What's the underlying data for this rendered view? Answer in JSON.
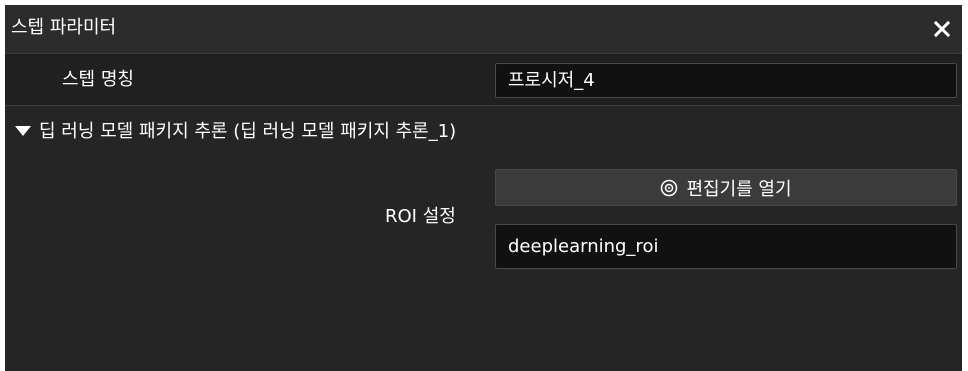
{
  "window": {
    "title": "스텝 파라미터",
    "close_icon": "close-icon"
  },
  "step_name": {
    "label": "스텝 명칭",
    "value": "프로시저_4"
  },
  "section": {
    "expanded_icon": "caret-down-icon",
    "title": "딥 러닝 모델 패키지 추론 (딥 러닝 모델 패키지 추론_1)"
  },
  "roi": {
    "label": "ROI 설정",
    "editor_button_label": "편집기를 열기",
    "editor_button_icon": "target-icon",
    "value": "deeplearning_roi"
  },
  "colors": {
    "background": "#252525",
    "title_bar": "#2c2c2c",
    "field_background": "#111111",
    "button_background": "#3b3b3b",
    "text": "#ffffff"
  }
}
